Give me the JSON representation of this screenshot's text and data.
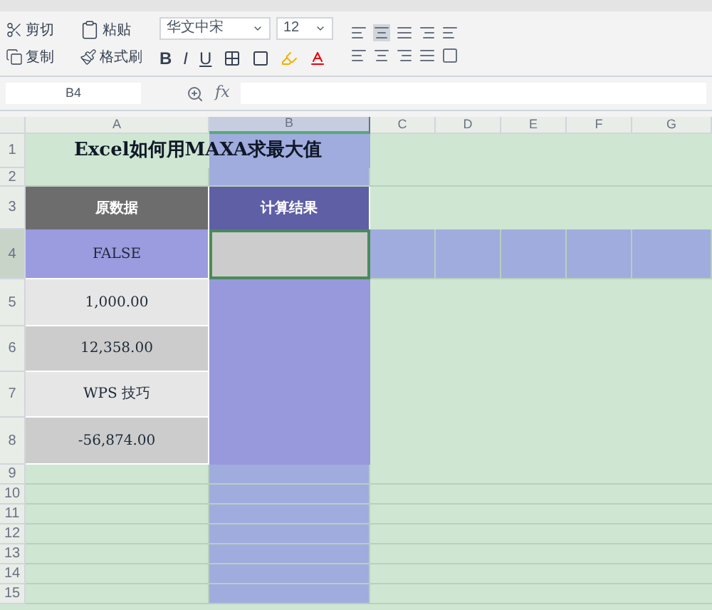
{
  "toolbar": {
    "clipboard": [
      {
        "label": "剪切",
        "kind": "cut"
      },
      {
        "label": "粘贴",
        "kind": "paste"
      },
      {
        "label": "复制",
        "kind": "copy"
      },
      {
        "label": "格式刷",
        "kind": "brush"
      }
    ],
    "font_name": "华文中宋",
    "font_size": "12",
    "styles": [
      "B",
      "I",
      "U"
    ]
  },
  "formula_bar": {
    "name_box": "B4",
    "function_label": "fx"
  },
  "columns": [
    {
      "label": "A",
      "selected": false
    },
    {
      "label": "B",
      "selected": true
    },
    {
      "label": "C",
      "selected": false
    },
    {
      "label": "D",
      "selected": false
    },
    {
      "label": "E",
      "selected": false
    },
    {
      "label": "F",
      "selected": false
    },
    {
      "label": "G",
      "selected": false
    }
  ],
  "title_row": {
    "number": "1",
    "title": "Excel如何用MAXA求最大值"
  },
  "blank_row": {
    "number": "2"
  },
  "header_row": {
    "number": "3",
    "cells": [
      "原数据",
      "计算结果"
    ]
  },
  "data_rows": [
    {
      "number": "4",
      "value": "FALSE",
      "selected": true
    },
    {
      "number": "5",
      "value": "1,000.00",
      "selected": false
    },
    {
      "number": "6",
      "value": "12,358.00",
      "selected": false
    },
    {
      "number": "7",
      "value": "WPS 技巧",
      "selected": false
    },
    {
      "number": "8",
      "value": "-56,874.00",
      "selected": false
    }
  ],
  "empty_rows": [
    "9",
    "10",
    "11",
    "12",
    "13",
    "14",
    "15"
  ]
}
